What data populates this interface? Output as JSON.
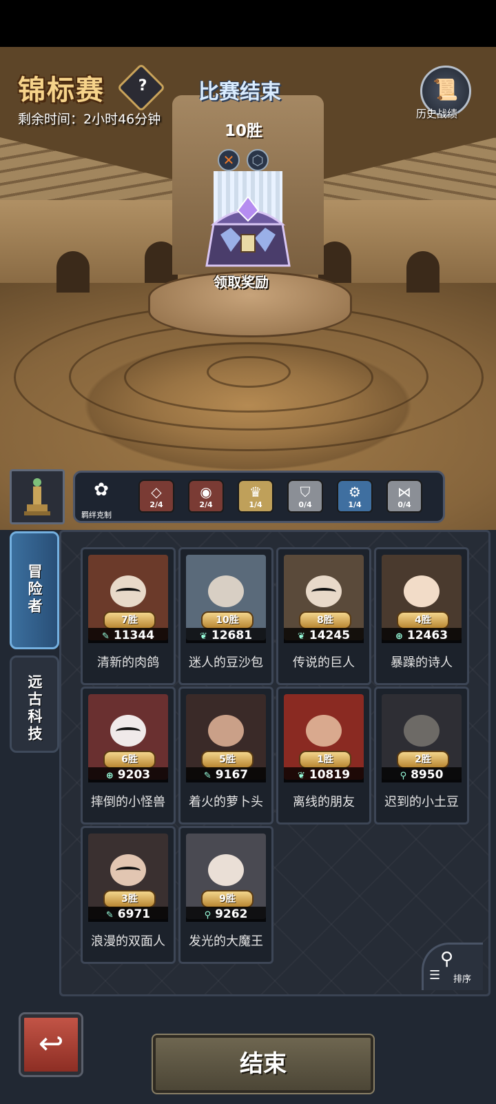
{
  "header": {
    "title": "锦标赛",
    "help_icon": "?",
    "remaining_time": "剩余时间：2小时46分钟",
    "match_status": "比赛结束",
    "wins": "10胜",
    "history_label": "历史战绩",
    "claim_reward": "领取奖励"
  },
  "synergy": {
    "label": "羁绊克制",
    "items": [
      {
        "icon": "diamond-sigil-icon",
        "count": "2/4",
        "color": "#7a3b34"
      },
      {
        "icon": "eye-sigil-icon",
        "count": "2/4",
        "color": "#7a3b34"
      },
      {
        "icon": "crown-sigil-icon",
        "count": "1/4",
        "color": "#bfa05a"
      },
      {
        "icon": "shield-sigil-icon",
        "count": "0/4",
        "color": "#8b8f96"
      },
      {
        "icon": "gear-sigil-icon",
        "count": "1/4",
        "color": "#3f6fa0"
      },
      {
        "icon": "wing-sigil-icon",
        "count": "0/4",
        "color": "#8b8f96"
      }
    ]
  },
  "tabs": {
    "adventurer": "冒险者",
    "ancient_tech": "远古科技"
  },
  "heroes": [
    {
      "wins": "7胜",
      "power": "11344",
      "name": "清新的肉鸽",
      "bg": "#6b3a2a"
    },
    {
      "wins": "10胜",
      "power": "12681",
      "name": "迷人的豆沙包",
      "bg": "#5a6a7a"
    },
    {
      "wins": "8胜",
      "power": "14245",
      "name": "传说的巨人",
      "bg": "#5a4a3a"
    },
    {
      "wins": "4胜",
      "power": "12463",
      "name": "暴躁的诗人",
      "bg": "#4a3a2e"
    },
    {
      "wins": "6胜",
      "power": "9203",
      "name": "摔倒的小怪兽",
      "bg": "#6a3030"
    },
    {
      "wins": "5胜",
      "power": "9167",
      "name": "着火的萝卜头",
      "bg": "#3a2a28"
    },
    {
      "wins": "1胜",
      "power": "10819",
      "name": "离线的朋友",
      "bg": "#8a2a22"
    },
    {
      "wins": "2胜",
      "power": "8950",
      "name": "迟到的小土豆",
      "bg": "#2e2e34"
    },
    {
      "wins": "3胜",
      "power": "6971",
      "name": "浪漫的双面人",
      "bg": "#3a3030"
    },
    {
      "wins": "9胜",
      "power": "9262",
      "name": "发光的大魔王",
      "bg": "#4a4a52"
    }
  ],
  "controls": {
    "sort_label": "排序",
    "end_button": "结束",
    "back_icon": "undo-arrow-icon"
  }
}
